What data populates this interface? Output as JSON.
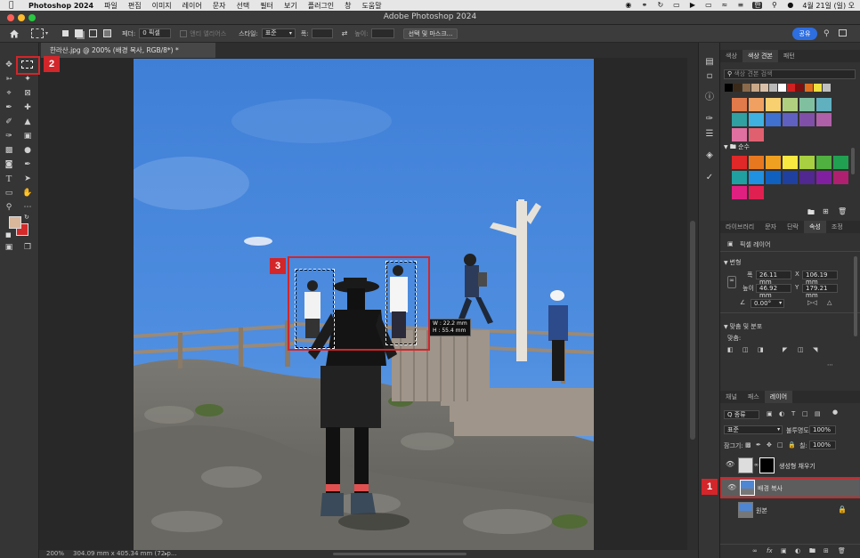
{
  "menubar": {
    "app_name": "Photoshop 2024",
    "items": [
      "파일",
      "편집",
      "이미지",
      "레이어",
      "문자",
      "선택",
      "필터",
      "보기",
      "플러그인",
      "창",
      "도움말"
    ],
    "clock": "4월 21일 (일) 오",
    "input_lang": "한"
  },
  "window": {
    "title": "Adobe Photoshop 2024"
  },
  "options": {
    "feather_label": "페더:",
    "feather_value": "0 픽셀",
    "antialias_label": "앤티 앨리어스",
    "style_label": "스타일:",
    "style_value": "표준",
    "width_label": "폭:",
    "height_label": "높이:",
    "select_mask_button": "선택 및 마스크...",
    "share_button": "공유"
  },
  "document": {
    "tab_title": "한라산.jpg @ 200% (배경 복사, RGB/8*) *",
    "zoom": "200%",
    "dimensions": "304.09 mm x 405.34 mm (72 p..."
  },
  "selection": {
    "width_readout": "W : 22.2 mm",
    "height_readout": "H : 55.4 mm"
  },
  "callouts": [
    "1",
    "2",
    "3"
  ],
  "swatches_panel": {
    "tabs": [
      "색상",
      "색상 견본",
      "패턴"
    ],
    "active_tab": "색상 견본",
    "search_placeholder": "색상 견본 검색",
    "recent_colors": [
      "#000000",
      "#3a2a1a",
      "#8a6a4a",
      "#c8a888",
      "#d8c0a8",
      "#b8b8b8",
      "#ffffff",
      "#d02020",
      "#7a1010",
      "#e07020",
      "#f0e040",
      "#c0c0c0"
    ],
    "group_colors": [
      "#e07a4a",
      "#f0a060",
      "#f8d070",
      "#b0d080",
      "#80c0a0",
      "#60b0c0",
      "#30a0a0",
      "#40b0e0",
      "#4070d0",
      "#6060c0",
      "#8050a8",
      "#b060a8",
      "#e070a0",
      "#e06070"
    ],
    "pure_group_label": "순수",
    "pure_colors": [
      "#e02828",
      "#e87820",
      "#f0a020",
      "#f8e840",
      "#a8d040",
      "#50b040",
      "#20a050",
      "#20a0a0",
      "#2090e0",
      "#1060c0",
      "#2040a0",
      "#502890",
      "#8020a0",
      "#b02070",
      "#e02080",
      "#e02050"
    ]
  },
  "properties_panel": {
    "tabs": [
      "라이브러리",
      "문자",
      "단락",
      "속성",
      "조정"
    ],
    "active_tab": "속성",
    "layer_type": "픽셀 레이어",
    "transform_label": "변형",
    "w_label": "폭",
    "w_value": "26.11 mm",
    "h_label": "높이",
    "h_value": "46.92 mm",
    "x_label": "X",
    "x_value": "106.19 mm",
    "y_label": "Y",
    "y_value": "179.21 mm",
    "angle_value": "0.00°",
    "align_label": "맞춤 및 분포",
    "align_sub": "맞춤:"
  },
  "layers_panel": {
    "tabs": [
      "채널",
      "패스",
      "레이어"
    ],
    "active_tab": "레이어",
    "filter_label": "Q 종류",
    "blend_mode": "표준",
    "opacity_label": "불투명도:",
    "opacity_value": "100%",
    "lock_label": "잠그기:",
    "fill_label": "칠:",
    "fill_value": "100%",
    "layers": [
      {
        "name": "생성형 채우기"
      },
      {
        "name": "배경 복사"
      },
      {
        "name": "원본"
      }
    ]
  },
  "colors": {
    "foreground": "#d9b79a",
    "background": "#d42a2a",
    "accent": "#2d6ee0",
    "callout": "#d2262a"
  }
}
